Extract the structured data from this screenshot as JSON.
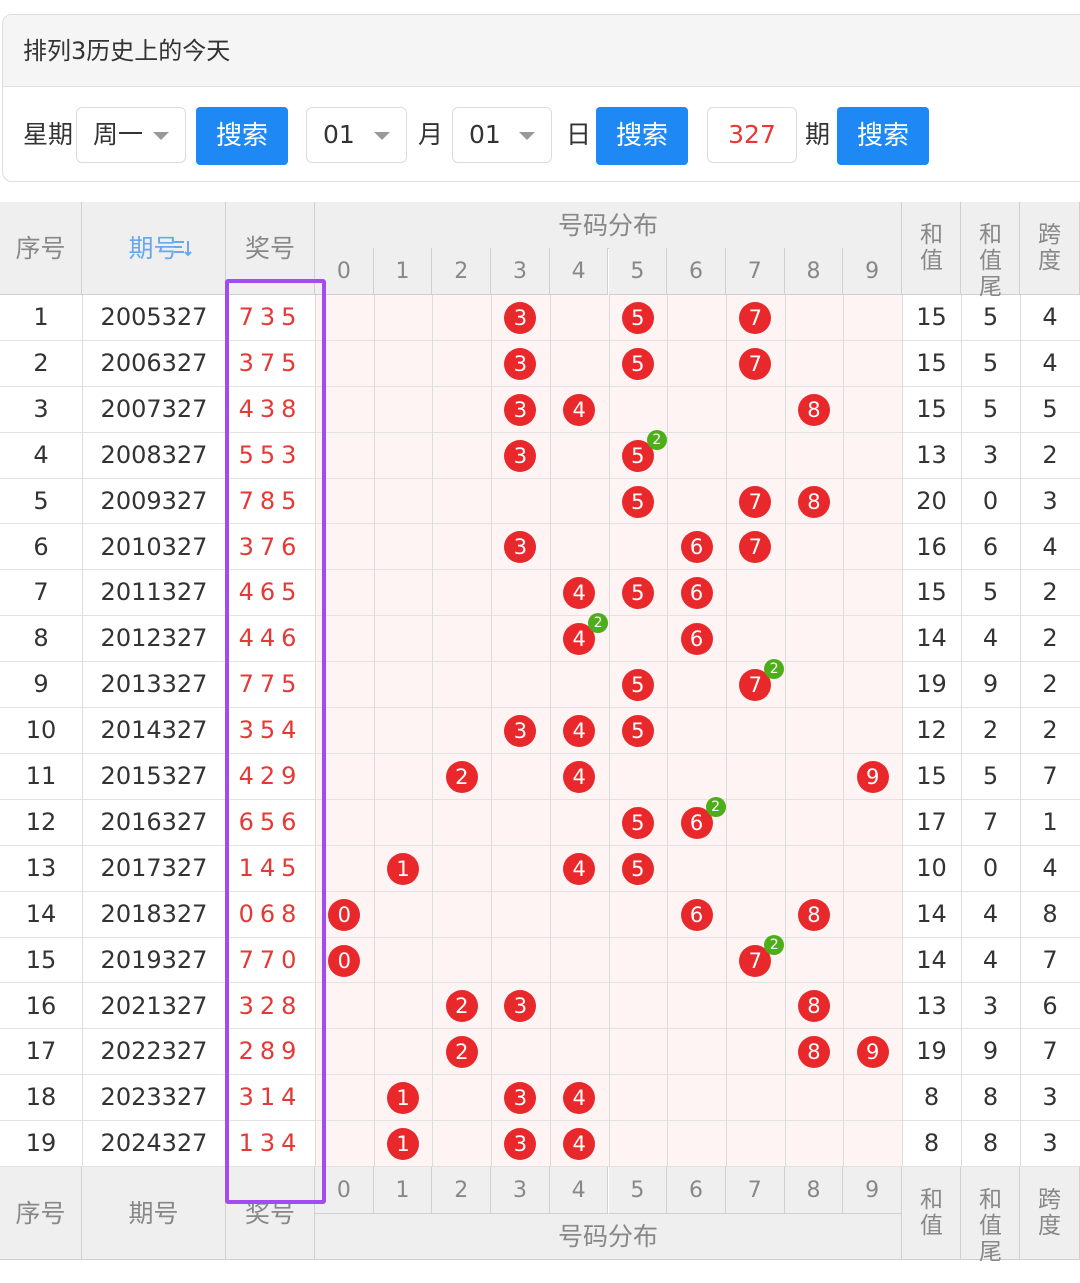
{
  "header": {
    "title": "排列3历史上的今天"
  },
  "form": {
    "weekday_label": "星期",
    "weekday_value": "周一",
    "search1": "搜索",
    "month_value": "01",
    "month_label": "月",
    "day_value": "01",
    "day_label": "日",
    "search2": "搜索",
    "issue_value": "327",
    "issue_label": "期",
    "search3": "搜索"
  },
  "table": {
    "col_seq": "序号",
    "col_issue": "期号",
    "col_issue_sort_icon": "sort-icon",
    "col_win": "奖号",
    "col_dist": "号码分布",
    "col_sum": "和值",
    "col_sum_tail": "和值尾",
    "col_span": "跨度",
    "digits": [
      "0",
      "1",
      "2",
      "3",
      "4",
      "5",
      "6",
      "7",
      "8",
      "9"
    ],
    "rows": [
      {
        "seq": "1",
        "issue": "2005327",
        "win": "735",
        "sum": "15",
        "tail": "5",
        "span": "4"
      },
      {
        "seq": "2",
        "issue": "2006327",
        "win": "375",
        "sum": "15",
        "tail": "5",
        "span": "4"
      },
      {
        "seq": "3",
        "issue": "2007327",
        "win": "438",
        "sum": "15",
        "tail": "5",
        "span": "5"
      },
      {
        "seq": "4",
        "issue": "2008327",
        "win": "553",
        "sum": "13",
        "tail": "3",
        "span": "2"
      },
      {
        "seq": "5",
        "issue": "2009327",
        "win": "785",
        "sum": "20",
        "tail": "0",
        "span": "3"
      },
      {
        "seq": "6",
        "issue": "2010327",
        "win": "376",
        "sum": "16",
        "tail": "6",
        "span": "4"
      },
      {
        "seq": "7",
        "issue": "2011327",
        "win": "465",
        "sum": "15",
        "tail": "5",
        "span": "2"
      },
      {
        "seq": "8",
        "issue": "2012327",
        "win": "446",
        "sum": "14",
        "tail": "4",
        "span": "2"
      },
      {
        "seq": "9",
        "issue": "2013327",
        "win": "775",
        "sum": "19",
        "tail": "9",
        "span": "2"
      },
      {
        "seq": "10",
        "issue": "2014327",
        "win": "354",
        "sum": "12",
        "tail": "2",
        "span": "2"
      },
      {
        "seq": "11",
        "issue": "2015327",
        "win": "429",
        "sum": "15",
        "tail": "5",
        "span": "7"
      },
      {
        "seq": "12",
        "issue": "2016327",
        "win": "656",
        "sum": "17",
        "tail": "7",
        "span": "1"
      },
      {
        "seq": "13",
        "issue": "2017327",
        "win": "145",
        "sum": "10",
        "tail": "0",
        "span": "4"
      },
      {
        "seq": "14",
        "issue": "2018327",
        "win": "068",
        "sum": "14",
        "tail": "4",
        "span": "8"
      },
      {
        "seq": "15",
        "issue": "2019327",
        "win": "770",
        "sum": "14",
        "tail": "4",
        "span": "7"
      },
      {
        "seq": "16",
        "issue": "2021327",
        "win": "328",
        "sum": "13",
        "tail": "3",
        "span": "6"
      },
      {
        "seq": "17",
        "issue": "2022327",
        "win": "289",
        "sum": "19",
        "tail": "9",
        "span": "7"
      },
      {
        "seq": "18",
        "issue": "2023327",
        "win": "314",
        "sum": "8",
        "tail": "8",
        "span": "3"
      },
      {
        "seq": "19",
        "issue": "2024327",
        "win": "134",
        "sum": "8",
        "tail": "8",
        "span": "3"
      }
    ]
  },
  "colors": {
    "ball": "#e8282b",
    "repeat_badge": "#4caf1a",
    "button": "#1e88f5",
    "highlight_box": "#a24cf0",
    "win_text": "#e53935"
  }
}
